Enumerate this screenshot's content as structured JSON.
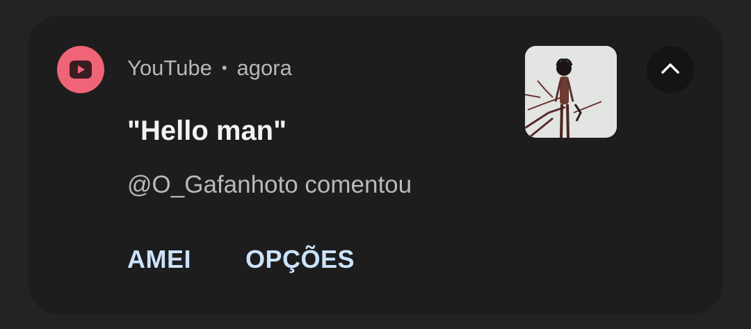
{
  "notification": {
    "app_name": "YouTube",
    "separator": "•",
    "time": "agora",
    "title": "\"Hello man\"",
    "subtitle": "@O_Gafanhoto comentou",
    "actions": {
      "like_label": "AMEI",
      "options_label": "OPÇÕES"
    }
  },
  "colors": {
    "accent": "#f06477",
    "action_text": "#cbe2fb",
    "card_background": "#1d1d1e",
    "screen_background": "#232323"
  },
  "icons": {
    "app": "youtube-icon",
    "expand": "chevron-up-icon"
  }
}
